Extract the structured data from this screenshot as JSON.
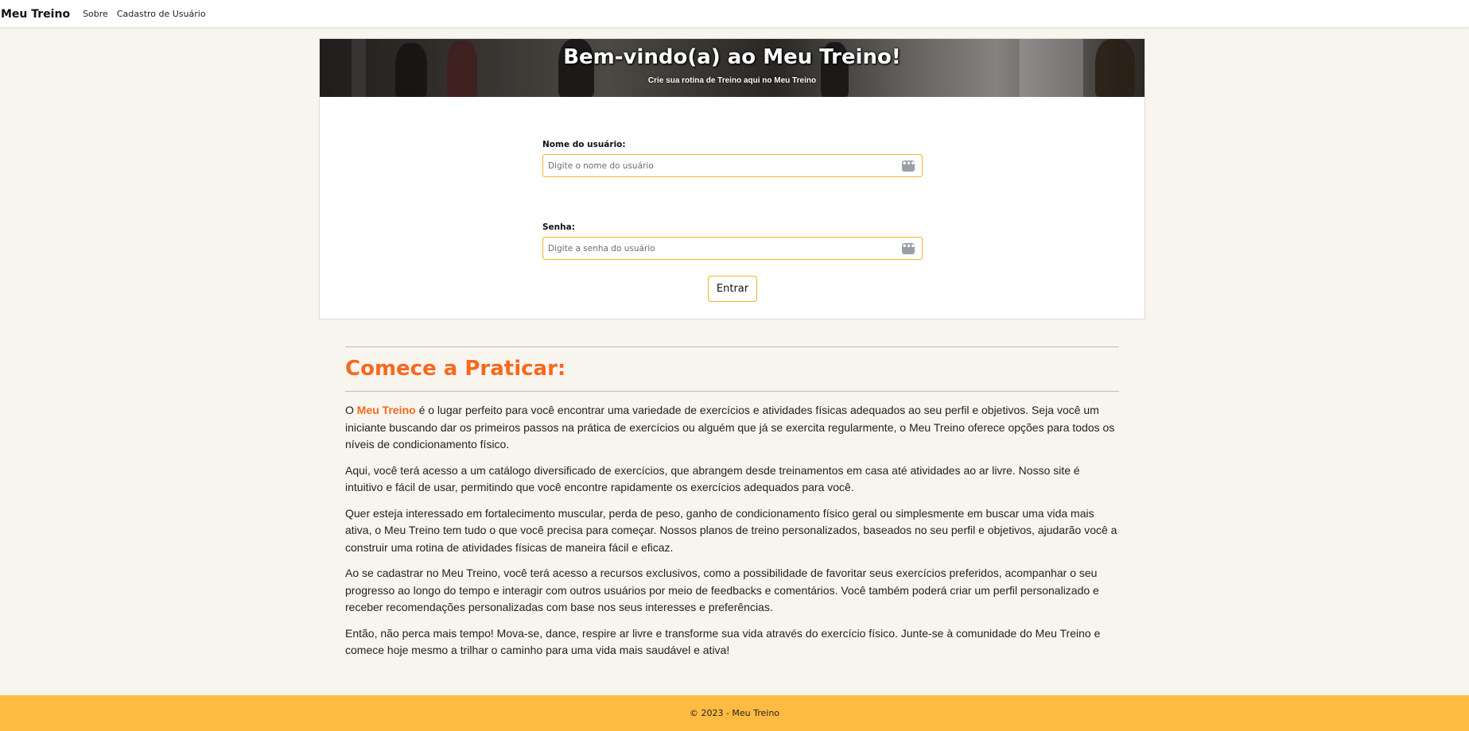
{
  "navbar": {
    "brand": "Meu Treino",
    "links": [
      "Sobre",
      "Cadastro de Usuário"
    ]
  },
  "hero": {
    "title": "Bem-vindo(a) ao Meu Treino!",
    "subtitle": "Crie sua rotina de Treino aqui no Meu Treino"
  },
  "form": {
    "username_label": "Nome do usuário:",
    "username_placeholder": "Digite o nome do usuário",
    "password_label": "Senha:",
    "password_placeholder": "Digite a senha do usuário",
    "submit_label": "Entrar",
    "field_icon": "password-manager-dots-icon"
  },
  "article": {
    "title": "Comece a Praticar:",
    "p1_prefix": "O ",
    "p1_brand": "Meu Treino",
    "p1_rest": " é o lugar perfeito para você encontrar uma variedade de exercícios e atividades físicas adequados ao seu perfil e objetivos. Seja você um iniciante buscando dar os primeiros passos na prática de exercícios ou alguém que já se exercita regularmente, o Meu Treino oferece opções para todos os níveis de condicionamento físico.",
    "p2": "Aqui, você terá acesso a um catálogo diversificado de exercícios, que abrangem desde treinamentos em casa até atividades ao ar livre. Nosso site é intuitivo e fácil de usar, permitindo que você encontre rapidamente os exercícios adequados para você.",
    "p3": "Quer esteja interessado em fortalecimento muscular, perda de peso, ganho de condicionamento físico geral ou simplesmente em buscar uma vida mais ativa, o Meu Treino tem tudo o que você precisa para começar. Nossos planos de treino personalizados, baseados no seu perfil e objetivos, ajudarão você a construir uma rotina de atividades físicas de maneira fácil e eficaz.",
    "p4": "Ao se cadastrar no Meu Treino, você terá acesso a recursos exclusivos, como a possibilidade de favoritar seus exercícios preferidos, acompanhar o seu progresso ao longo do tempo e interagir com outros usuários por meio de feedbacks e comentários. Você também poderá criar um perfil personalizado e receber recomendações personalizadas com base nos seus interesses e preferências.",
    "p5": "Então, não perca mais tempo! Mova-se, dance, respire ar livre e transforme sua vida através do exercício físico. Junte-se à comunidade do Meu Treino e comece hoje mesmo a trilhar o caminho para uma vida mais saudável e ativa!"
  },
  "footer": {
    "text": "© 2023 - Meu Treino"
  },
  "colors": {
    "accent_orange": "#f7691d",
    "footer_yellow": "#ffbb42",
    "input_border": "#f5b325",
    "page_background": "#f8f4ee"
  }
}
